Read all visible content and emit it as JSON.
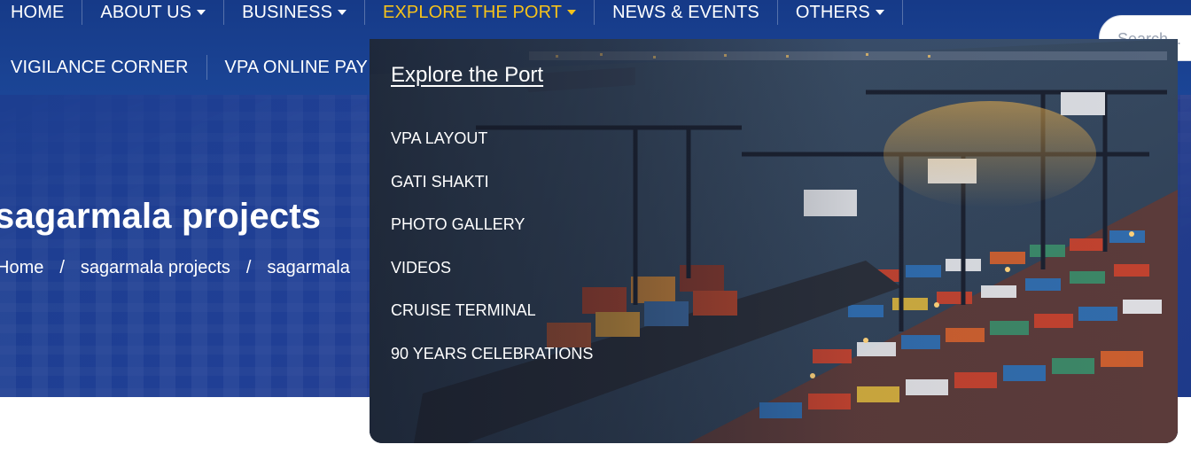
{
  "nav": {
    "row1": [
      {
        "label": "HOME",
        "caret": false,
        "active": false
      },
      {
        "label": "ABOUT US",
        "caret": true,
        "active": false
      },
      {
        "label": "BUSINESS",
        "caret": true,
        "active": false
      },
      {
        "label": "EXPLORE THE PORT",
        "caret": true,
        "active": true
      },
      {
        "label": "NEWS & EVENTS",
        "caret": false,
        "active": false
      },
      {
        "label": "OTHERS",
        "caret": true,
        "active": false
      }
    ],
    "row2": [
      {
        "label": "VIGILANCE CORNER"
      },
      {
        "label": "VPA ONLINE PAY"
      }
    ]
  },
  "search": {
    "placeholder": "Search..."
  },
  "hero": {
    "title": "sagarmala projects",
    "breadcrumb": [
      "Home",
      "sagarmala projects",
      "sagarmala"
    ]
  },
  "dropdown": {
    "title": "Explore the Port",
    "items": [
      "VPA LAYOUT",
      "GATI SHAKTI",
      "PHOTO GALLERY",
      "VIDEOS",
      "CRUISE TERMINAL",
      "90 YEARS CELEBRATIONS"
    ]
  },
  "colors": {
    "nav_bg": "#1a3f8f",
    "active": "#f5c21b",
    "text": "#ffffff"
  }
}
